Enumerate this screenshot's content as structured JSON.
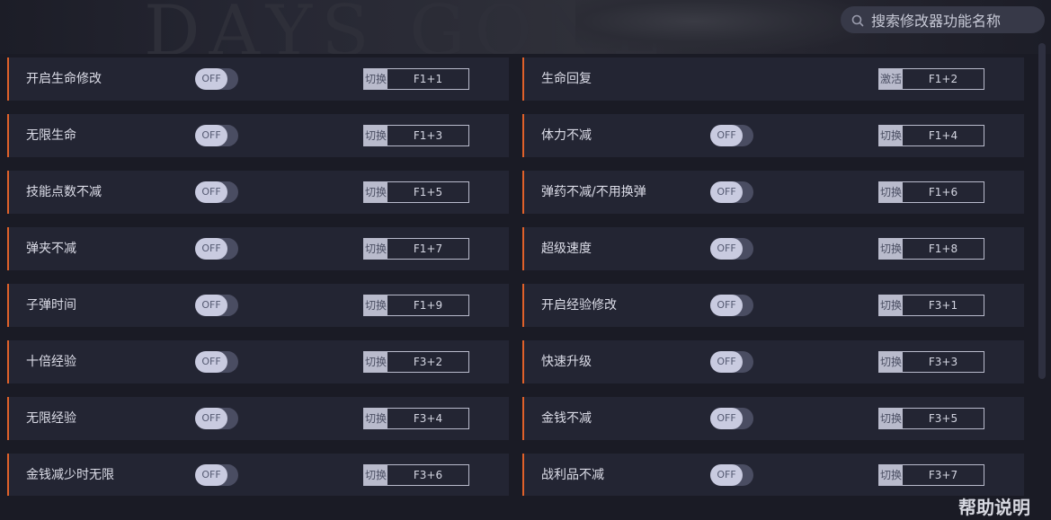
{
  "banner": {
    "background_text": "DAYS GONE"
  },
  "search": {
    "placeholder": "搜索修改器功能名称"
  },
  "rows": [
    {
      "left": {
        "label": "开启生命修改",
        "toggle": "OFF",
        "hotkey_type": "切换",
        "hotkey": "F1+1"
      },
      "right": {
        "label": "生命回复",
        "toggle": null,
        "hotkey_type": "激活",
        "hotkey": "F1+2"
      }
    },
    {
      "left": {
        "label": "无限生命",
        "toggle": "OFF",
        "hotkey_type": "切换",
        "hotkey": "F1+3"
      },
      "right": {
        "label": "体力不减",
        "toggle": "OFF",
        "hotkey_type": "切换",
        "hotkey": "F1+4"
      }
    },
    {
      "left": {
        "label": "技能点数不减",
        "toggle": "OFF",
        "hotkey_type": "切换",
        "hotkey": "F1+5"
      },
      "right": {
        "label": "弹药不减/不用换弹",
        "toggle": "OFF",
        "hotkey_type": "切换",
        "hotkey": "F1+6"
      }
    },
    {
      "left": {
        "label": "弹夹不减",
        "toggle": "OFF",
        "hotkey_type": "切换",
        "hotkey": "F1+7"
      },
      "right": {
        "label": "超级速度",
        "toggle": "OFF",
        "hotkey_type": "切换",
        "hotkey": "F1+8"
      }
    },
    {
      "left": {
        "label": "子弹时间",
        "toggle": "OFF",
        "hotkey_type": "切换",
        "hotkey": "F1+9"
      },
      "right": {
        "label": "开启经验修改",
        "toggle": "OFF",
        "hotkey_type": "切换",
        "hotkey": "F3+1"
      }
    },
    {
      "left": {
        "label": "十倍经验",
        "toggle": "OFF",
        "hotkey_type": "切换",
        "hotkey": "F3+2"
      },
      "right": {
        "label": "快速升级",
        "toggle": "OFF",
        "hotkey_type": "切换",
        "hotkey": "F3+3"
      }
    },
    {
      "left": {
        "label": "无限经验",
        "toggle": "OFF",
        "hotkey_type": "切换",
        "hotkey": "F3+4"
      },
      "right": {
        "label": "金钱不减",
        "toggle": "OFF",
        "hotkey_type": "切换",
        "hotkey": "F3+5"
      }
    },
    {
      "left": {
        "label": "金钱减少时无限",
        "toggle": "OFF",
        "hotkey_type": "切换",
        "hotkey": "F3+6"
      },
      "right": {
        "label": "战利品不减",
        "toggle": "OFF",
        "hotkey_type": "切换",
        "hotkey": "F3+7"
      }
    }
  ],
  "footer": {
    "help_label": "帮助说明"
  },
  "colors": {
    "accent": "#e0612a",
    "background": "#1a1b25",
    "row_bg": "#232533",
    "toggle_knob": "#c9cbe0"
  },
  "icons": {
    "search": "search-icon"
  }
}
